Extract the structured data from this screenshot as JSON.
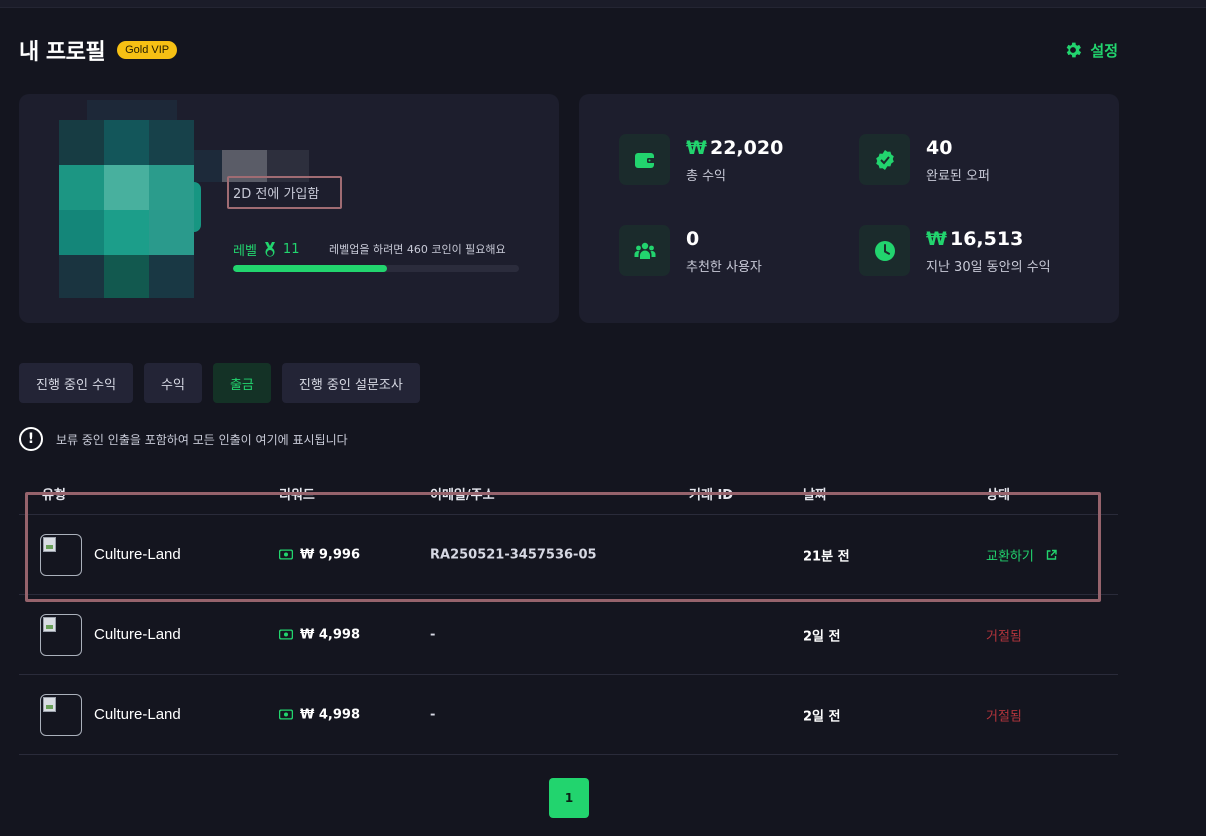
{
  "header": {
    "title": "내 프로필",
    "badge": "Gold VIP",
    "settings_label": "설정"
  },
  "profile": {
    "joined": "2D 전에 가입함",
    "level_label": "레벨",
    "level_value": "11",
    "level_need": "레벨업을 하려면 460 코인이 필요해요",
    "level_progress_percent": 54
  },
  "stats": {
    "total_earnings": {
      "currency": "₩",
      "value": "22,020",
      "label": "총 수익",
      "icon": "wallet-icon"
    },
    "completed_offers": {
      "value": "40",
      "label": "완료된 오퍼",
      "icon": "verified-badge-icon"
    },
    "referred_users": {
      "value": "0",
      "label": "추천한 사용자",
      "icon": "users-icon"
    },
    "last30_earnings": {
      "currency": "₩",
      "value": "16,513",
      "label": "지난 30일 동안의 수익",
      "icon": "clock-icon"
    }
  },
  "tabs": [
    {
      "label": "진행 중인 수익",
      "active": false
    },
    {
      "label": "수익",
      "active": false
    },
    {
      "label": "출금",
      "active": true
    },
    {
      "label": "진행 중인 설문조사",
      "active": false
    }
  ],
  "notice": "보류 중인 인출을 포함하여 모든 인출이 여기에 표시됩니다",
  "table": {
    "headers": [
      "유형",
      "리워드",
      "이메일/주소",
      "거래 ID",
      "날짜",
      "상태"
    ],
    "rows": [
      {
        "type": "Culture-Land",
        "reward": "₩ 9,996",
        "address": "RA250521-3457536-05",
        "txid": "",
        "date": "21분 전",
        "status": "교환하기",
        "status_kind": "redeem"
      },
      {
        "type": "Culture-Land",
        "reward": "₩ 4,998",
        "address": "-",
        "txid": "",
        "date": "2일 전",
        "status": "거절됨",
        "status_kind": "rejected"
      },
      {
        "type": "Culture-Land",
        "reward": "₩ 4,998",
        "address": "-",
        "txid": "",
        "date": "2일 전",
        "status": "거절됨",
        "status_kind": "rejected"
      }
    ]
  },
  "pagination": {
    "current": "1"
  },
  "colors": {
    "accent": "#22d46e",
    "rejected": "#b3353c",
    "vip": "#f6c014",
    "card": "#1d1e2d",
    "background": "#14151f"
  }
}
